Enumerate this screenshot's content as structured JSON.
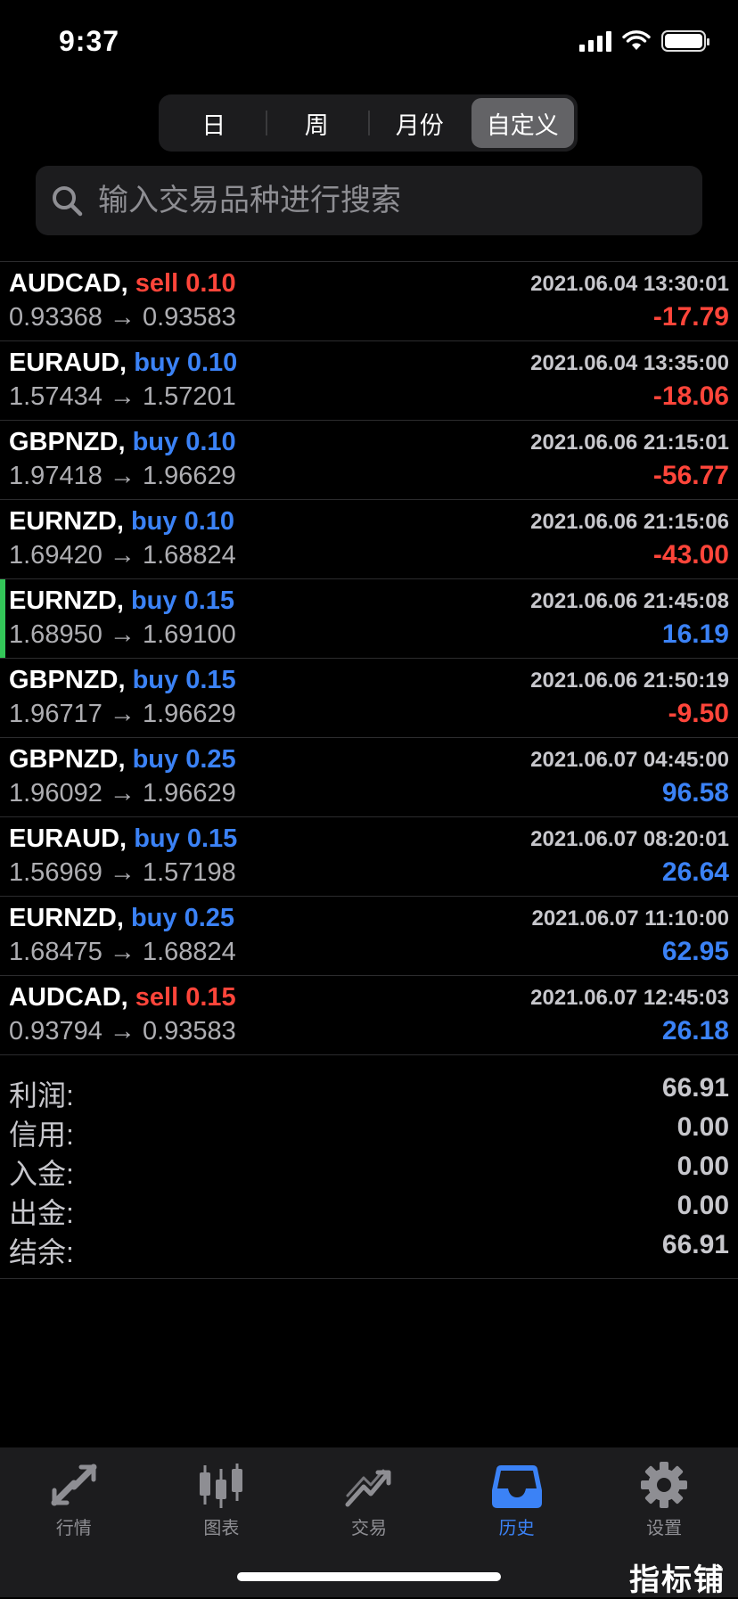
{
  "status_bar": {
    "time": "9:37"
  },
  "period_tabs": [
    {
      "label": "日",
      "active": false
    },
    {
      "label": "周",
      "active": false
    },
    {
      "label": "月份",
      "active": false
    },
    {
      "label": "自定义",
      "active": true
    }
  ],
  "search": {
    "placeholder": "输入交易品种进行搜索",
    "value": ""
  },
  "trades": [
    {
      "symbol": "AUDCAD,",
      "side": "sell",
      "volume": "0.10",
      "time": "2021.06.04 13:30:01",
      "open": "0.93368",
      "close": "0.93583",
      "profit": "-17.79",
      "marked": false
    },
    {
      "symbol": "EURAUD,",
      "side": "buy",
      "volume": "0.10",
      "time": "2021.06.04 13:35:00",
      "open": "1.57434",
      "close": "1.57201",
      "profit": "-18.06",
      "marked": false
    },
    {
      "symbol": "GBPNZD,",
      "side": "buy",
      "volume": "0.10",
      "time": "2021.06.06 21:15:01",
      "open": "1.97418",
      "close": "1.96629",
      "profit": "-56.77",
      "marked": false
    },
    {
      "symbol": "EURNZD,",
      "side": "buy",
      "volume": "0.10",
      "time": "2021.06.06 21:15:06",
      "open": "1.69420",
      "close": "1.68824",
      "profit": "-43.00",
      "marked": false
    },
    {
      "symbol": "EURNZD,",
      "side": "buy",
      "volume": "0.15",
      "time": "2021.06.06 21:45:08",
      "open": "1.68950",
      "close": "1.69100",
      "profit": "16.19",
      "marked": true
    },
    {
      "symbol": "GBPNZD,",
      "side": "buy",
      "volume": "0.15",
      "time": "2021.06.06 21:50:19",
      "open": "1.96717",
      "close": "1.96629",
      "profit": "-9.50",
      "marked": false
    },
    {
      "symbol": "GBPNZD,",
      "side": "buy",
      "volume": "0.25",
      "time": "2021.06.07 04:45:00",
      "open": "1.96092",
      "close": "1.96629",
      "profit": "96.58",
      "marked": false
    },
    {
      "symbol": "EURAUD,",
      "side": "buy",
      "volume": "0.15",
      "time": "2021.06.07 08:20:01",
      "open": "1.56969",
      "close": "1.57198",
      "profit": "26.64",
      "marked": false
    },
    {
      "symbol": "EURNZD,",
      "side": "buy",
      "volume": "0.25",
      "time": "2021.06.07 11:10:00",
      "open": "1.68475",
      "close": "1.68824",
      "profit": "62.95",
      "marked": false
    },
    {
      "symbol": "AUDCAD,",
      "side": "sell",
      "volume": "0.15",
      "time": "2021.06.07 12:45:03",
      "open": "0.93794",
      "close": "0.93583",
      "profit": "26.18",
      "marked": false
    }
  ],
  "arrow": "→",
  "summary": [
    {
      "label": "利润:",
      "value": "66.91"
    },
    {
      "label": "信用:",
      "value": "0.00"
    },
    {
      "label": "入金:",
      "value": "0.00"
    },
    {
      "label": "出金:",
      "value": "0.00"
    },
    {
      "label": "结余:",
      "value": "66.91"
    }
  ],
  "tabbar": [
    {
      "label": "行情",
      "icon": "quotes-arrows-icon",
      "active": false
    },
    {
      "label": "图表",
      "icon": "candlestick-chart-icon",
      "active": false
    },
    {
      "label": "交易",
      "icon": "trade-trend-icon",
      "active": false
    },
    {
      "label": "历史",
      "icon": "history-inbox-icon",
      "active": true
    },
    {
      "label": "设置",
      "icon": "gear-icon",
      "active": false
    }
  ],
  "watermark": "指标铺",
  "colors": {
    "sell": "#ff453a",
    "buy": "#3b82f6",
    "active_tab": "#3b82f6",
    "marker": "#34c759"
  }
}
